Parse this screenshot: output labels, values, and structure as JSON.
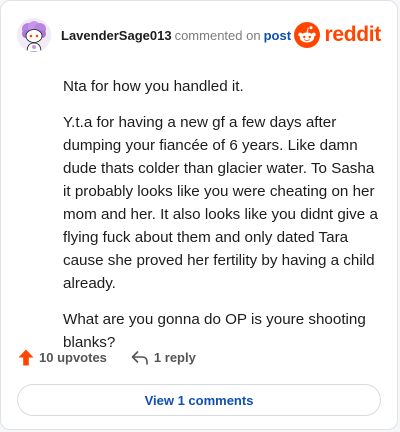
{
  "header": {
    "username": "LavenderSage013",
    "action": "commented on",
    "post_link": "post",
    "brand": "reddit"
  },
  "comment": {
    "paragraphs": [
      "Nta for how you handled it.",
      "Y.t.a for having a new gf a few days after dumping your fiancée of 6 years. Like damn dude thats colder than glacier water. To Sasha it probably looks like you were cheating on her mom and her. It also looks like you didnt give a flying fuck about them and only dated Tara cause she proved her fertility by having a child already.",
      "What are you gonna do OP is youre shooting blanks?"
    ]
  },
  "actions": {
    "upvotes": "10 upvotes",
    "replies": "1 reply",
    "view_comments": "View 1 comments"
  },
  "colors": {
    "brand": "#ff4500",
    "link": "#0f4fb0",
    "upvote": "#ff4500"
  },
  "icons": {
    "avatar": "snoo-avatar-icon",
    "logo": "reddit-logo-icon",
    "upvote": "upvote-arrow-icon",
    "reply": "reply-arrow-icon"
  }
}
